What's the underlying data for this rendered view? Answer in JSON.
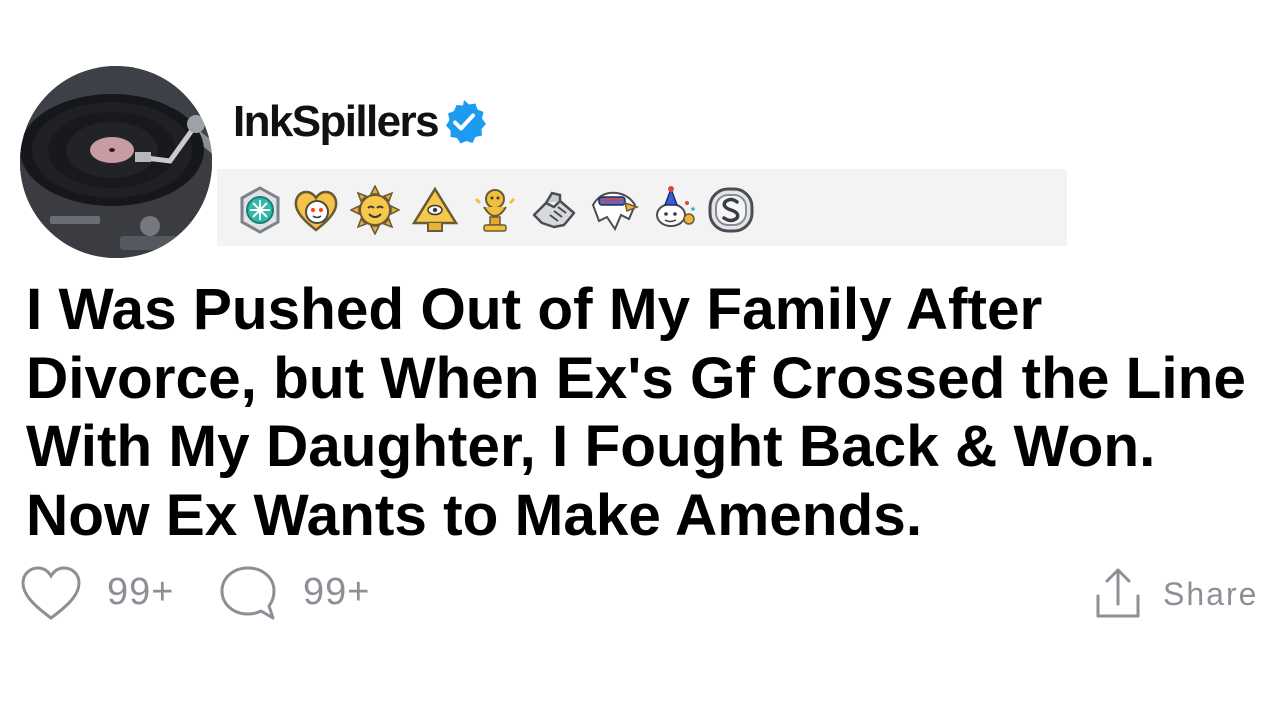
{
  "post": {
    "username": "InkSpillers",
    "verified": true,
    "title": "I Was Pushed Out of My Family After Divorce, but When Ex's Gf Crossed the Line With My Daughter, I Fought Back & Won. Now Ex Wants to Make Amends.",
    "avatar_icon": "record-player-icon",
    "awards": [
      "helpful-award-icon",
      "wholesome-heart-award-icon",
      "sun-award-icon",
      "pyramid-award-icon",
      "gold-trophy-award-icon",
      "handshake-award-icon",
      "eagle-award-icon",
      "snoo-party-award-icon",
      "silver-coin-award-icon"
    ],
    "actions": {
      "likes": "99+",
      "comments": "99+",
      "share_label": "Share"
    },
    "colors": {
      "verified_blue": "#1d9bf0",
      "action_gray": "#8c8f96",
      "awards_bg": "#f3f3f4"
    }
  }
}
